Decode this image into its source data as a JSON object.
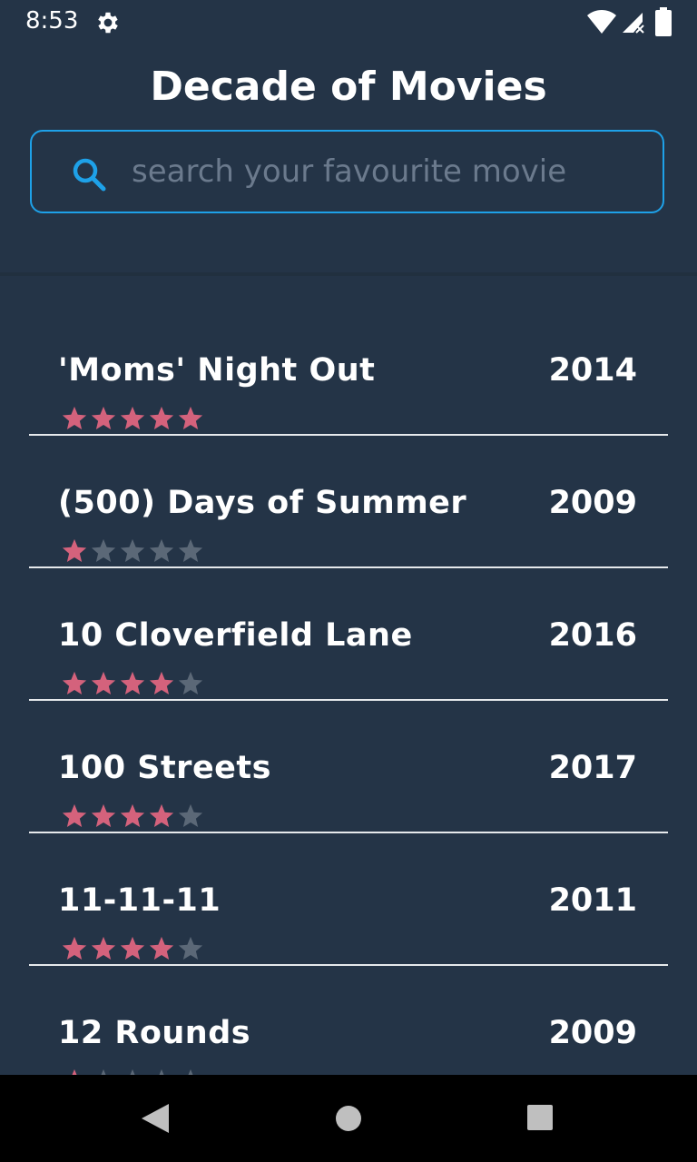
{
  "status_bar": {
    "time": "8:53",
    "icons": [
      "gear-icon",
      "wifi-icon",
      "signal-icon",
      "battery-icon"
    ]
  },
  "header": {
    "title": "Decade of Movies"
  },
  "search": {
    "placeholder": "search your favourite movie",
    "value": ""
  },
  "colors": {
    "background": "#243447",
    "accent": "#1ea1e8",
    "star_filled": "#d4627c",
    "star_empty": "#5b6877",
    "divider": "#e6e9ec"
  },
  "movies": [
    {
      "title": "'Moms' Night Out",
      "year": "2014",
      "rating": 5
    },
    {
      "title": "(500) Days of Summer",
      "year": "2009",
      "rating": 1
    },
    {
      "title": "10 Cloverfield Lane",
      "year": "2016",
      "rating": 4
    },
    {
      "title": "100 Streets",
      "year": "2017",
      "rating": 4
    },
    {
      "title": "11-11-11",
      "year": "2011",
      "rating": 4
    },
    {
      "title": "12 Rounds",
      "year": "2009",
      "rating": 1
    }
  ],
  "rating_max": 5,
  "nav_bar": {
    "icons": [
      "back-icon",
      "home-icon",
      "recents-icon"
    ]
  }
}
